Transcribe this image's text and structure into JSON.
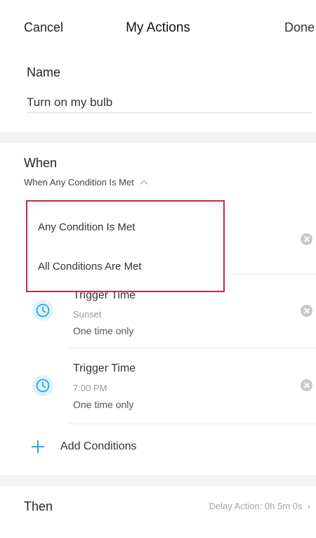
{
  "nav": {
    "cancel": "Cancel",
    "title": "My Actions",
    "done": "Done"
  },
  "name": {
    "label": "Name",
    "value": "Turn on my bulb"
  },
  "when": {
    "title": "When",
    "selector": "When Any Condition Is Met",
    "options": [
      "Any Condition Is Met",
      "All Conditions Are Met"
    ],
    "conditions": [
      {
        "title": "Trigger Time",
        "sub": "Sunset",
        "freq": "One time only"
      },
      {
        "title": "Trigger Time",
        "sub": "7:00 PM",
        "freq": "One time only"
      }
    ],
    "add_label": "Add Conditions"
  },
  "then": {
    "title": "Then",
    "delay": "Delay Action: 0h 5m 0s"
  },
  "colors": {
    "accent": "#2aa7e0",
    "highlight_border": "#c62b3b",
    "band": "#f4f4f4"
  },
  "icons": {
    "condition": "clock-icon",
    "remove": "remove-circle-icon",
    "add": "plus-icon",
    "chevron": "chevron-right-icon"
  }
}
